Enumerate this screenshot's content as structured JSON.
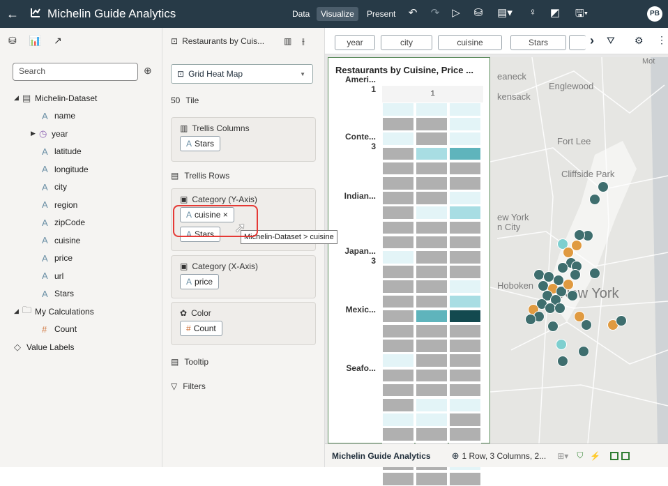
{
  "app": {
    "title": "Michelin Guide Analytics",
    "user_initials": "PB"
  },
  "modes": [
    "Data",
    "Visualize",
    "Present"
  ],
  "data_panel": {
    "search_placeholder": "Search",
    "tree": [
      {
        "label": "Michelin-Dataset",
        "kind": "dataset"
      },
      {
        "label": "name",
        "kind": "attr"
      },
      {
        "label": "year",
        "kind": "time"
      },
      {
        "label": "latitude",
        "kind": "attr"
      },
      {
        "label": "longitude",
        "kind": "attr"
      },
      {
        "label": "city",
        "kind": "attr"
      },
      {
        "label": "region",
        "kind": "attr"
      },
      {
        "label": "zipCode",
        "kind": "attr"
      },
      {
        "label": "cuisine",
        "kind": "attr"
      },
      {
        "label": "price",
        "kind": "attr"
      },
      {
        "label": "url",
        "kind": "attr"
      },
      {
        "label": "Stars",
        "kind": "attr"
      },
      {
        "label": "My Calculations",
        "kind": "folder"
      },
      {
        "label": "Count",
        "kind": "measure"
      },
      {
        "label": "Value Labels",
        "kind": "tag"
      }
    ]
  },
  "grammar_panel": {
    "viz_name": "Restaurants by Cuis...",
    "viz_type": "Grid Heat Map",
    "tile": "Tile",
    "trellis_columns": {
      "title": "Trellis Columns",
      "pills": [
        "Stars"
      ]
    },
    "trellis_rows": "Trellis Rows",
    "category_y": {
      "title": "Category (Y-Axis)",
      "pills": [
        "cuisine ×",
        "Stars"
      ]
    },
    "category_x": {
      "title": "Category (X-Axis)",
      "pills": [
        "price"
      ]
    },
    "color": {
      "title": "Color",
      "pills": [
        "Count"
      ]
    },
    "tooltip": "Tooltip",
    "filters": "Filters",
    "drag_tooltip": "Michelin-Dataset > cuisine"
  },
  "filter_chips": [
    "year",
    "city",
    "cuisine",
    "Stars"
  ],
  "viz": {
    "title": "Restaurants by Cuisine, Price ...",
    "column_header": "1",
    "row_groups": [
      {
        "label": "Ameri...",
        "sub": "1"
      },
      {
        "label": "Conte...",
        "sub": "3"
      },
      {
        "label": "Indian...",
        "sub": ""
      },
      {
        "label": "Japan...",
        "sub": "3"
      },
      {
        "label": "Mexic...",
        "sub": ""
      },
      {
        "label": "Seafo...",
        "sub": ""
      }
    ],
    "heat_colors": {
      "none": "#b0b0b0",
      "low": "#e3f4f7",
      "mid": "#a8dde3",
      "high": "#5fb4bc",
      "max": "#13494f"
    },
    "cells": [
      [
        "low",
        "low",
        "low"
      ],
      [
        "none",
        "none",
        "low"
      ],
      [
        "low",
        "none",
        "low"
      ],
      [
        "none",
        "mid",
        "high"
      ],
      [
        "none",
        "none",
        "none"
      ],
      [
        "none",
        "none",
        "none"
      ],
      [
        "none",
        "none",
        "low"
      ],
      [
        "none",
        "low",
        "mid"
      ],
      [
        "none",
        "none",
        "none"
      ],
      [
        "none",
        "none",
        "none"
      ],
      [
        "low",
        "none",
        "none"
      ],
      [
        "none",
        "none",
        "none"
      ],
      [
        "none",
        "none",
        "low"
      ],
      [
        "none",
        "none",
        "mid"
      ],
      [
        "none",
        "high",
        "max"
      ],
      [
        "none",
        "none",
        "none"
      ],
      [
        "none",
        "none",
        "none"
      ],
      [
        "low",
        "none",
        "none"
      ],
      [
        "none",
        "none",
        "none"
      ],
      [
        "none",
        "none",
        "none"
      ],
      [
        "none",
        "low",
        "low"
      ],
      [
        "low",
        "low",
        "none"
      ],
      [
        "none",
        "none",
        "none"
      ],
      [
        "none",
        "none",
        "none"
      ],
      [
        "none",
        "none",
        "low"
      ],
      [
        "none",
        "none",
        "none"
      ]
    ]
  },
  "map": {
    "labels": [
      "Englewood",
      "eaneck",
      "kensack",
      "Fort Lee",
      "Cliffside Park",
      "ew York",
      "n City",
      "Hoboken",
      "New York",
      "Mot"
    ],
    "colors": {
      "dark": "#3e6e6e",
      "teal": "#7ecfcf",
      "orange": "#e09a40"
    }
  },
  "status": {
    "project": "Michelin Guide Analytics",
    "summary": "1 Row, 3 Columns, 2..."
  }
}
